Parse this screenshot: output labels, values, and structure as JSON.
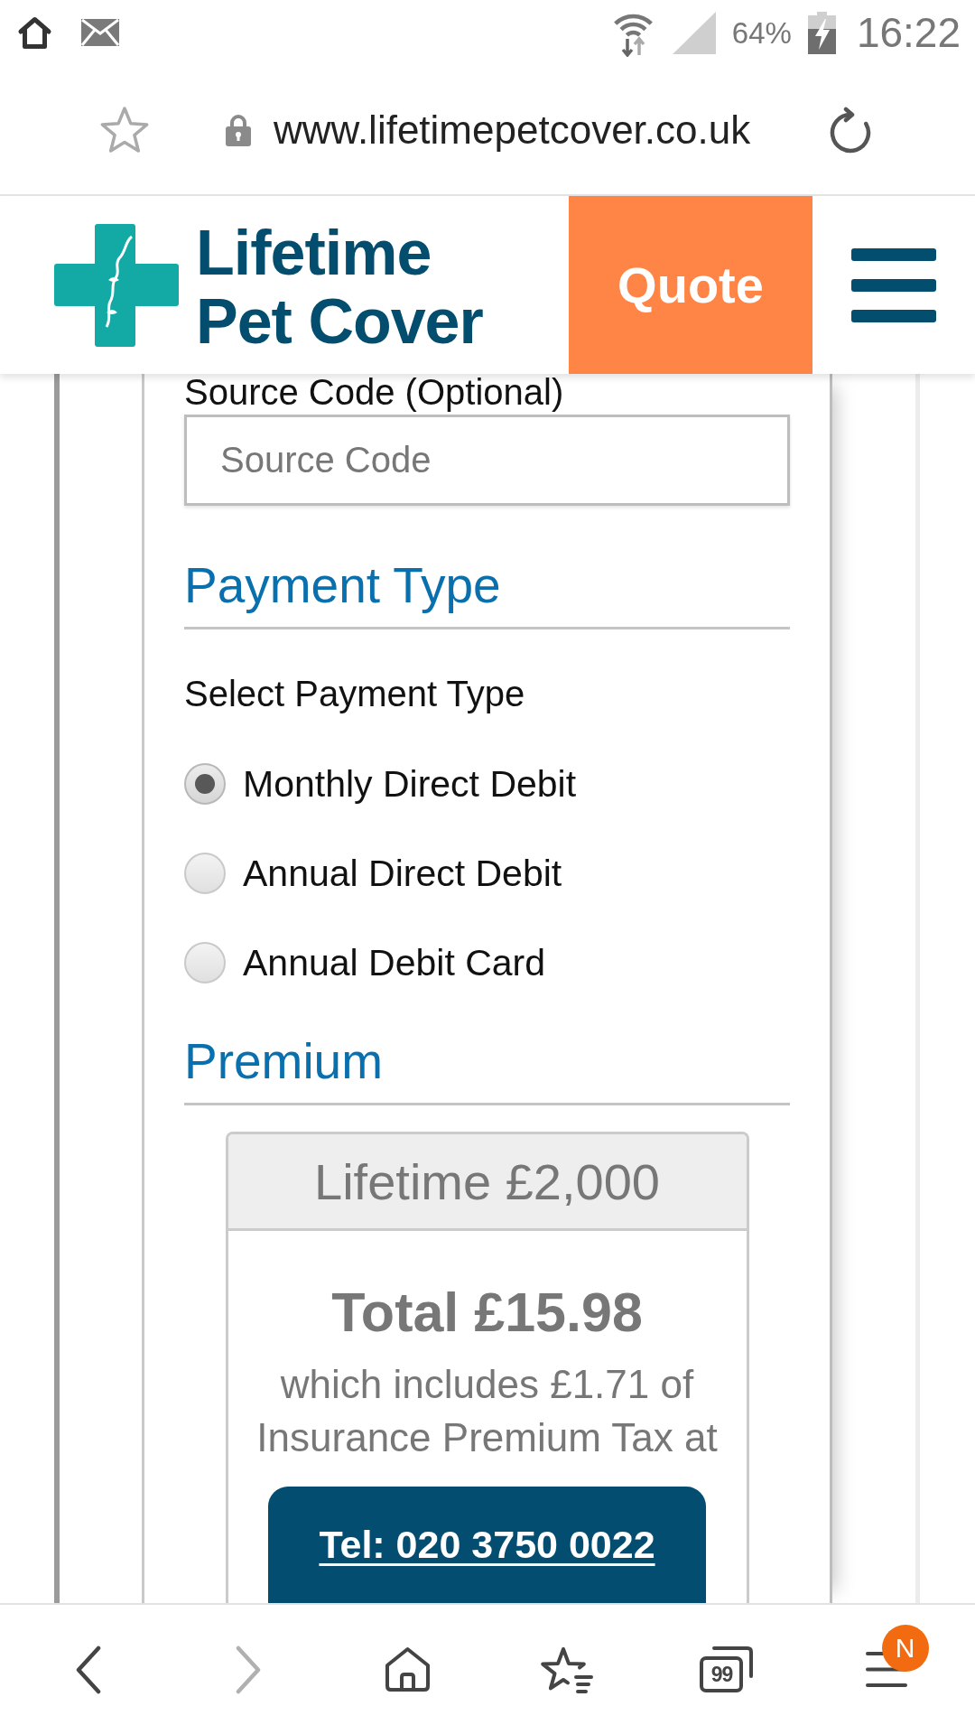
{
  "status_bar": {
    "battery": "64%",
    "time": "16:22"
  },
  "address_bar": {
    "url": "www.lifetimepetcover.co.uk"
  },
  "site_header": {
    "logo_text": [
      "Lifetime",
      "Pet Cover"
    ],
    "quote_button": "Quote"
  },
  "source_code": {
    "label": "Source Code (Optional)",
    "placeholder": "Source Code"
  },
  "payment_type": {
    "heading": "Payment Type",
    "prompt": "Select Payment Type",
    "options": [
      {
        "label": "Monthly Direct Debit",
        "selected": true
      },
      {
        "label": "Annual Direct Debit",
        "selected": false
      },
      {
        "label": "Annual Debit Card",
        "selected": false
      }
    ]
  },
  "premium": {
    "heading": "Premium",
    "plan": "Lifetime £2,000",
    "total": "Total £15.98",
    "tax_note": "which includes £1.71 of Insurance Premium Tax at"
  },
  "call_button": "Tel: 020 3750 0022",
  "bottom_nav": [
    {
      "kind": "back",
      "disabled": false
    },
    {
      "kind": "forward",
      "disabled": true
    },
    {
      "kind": "home",
      "disabled": false
    },
    {
      "kind": "bookmarks",
      "disabled": false
    },
    {
      "kind": "tabs",
      "disabled": false,
      "count": "99"
    },
    {
      "kind": "menu",
      "disabled": false,
      "badge": "N"
    }
  ]
}
